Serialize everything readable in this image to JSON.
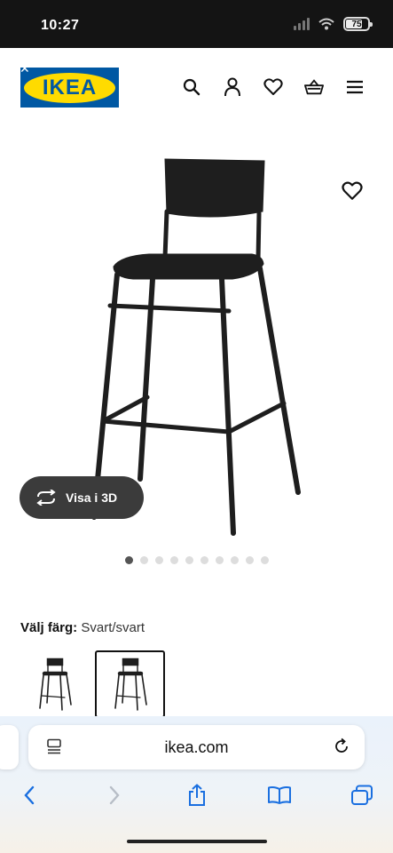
{
  "status_bar": {
    "time": "10:27",
    "battery": "75"
  },
  "header": {
    "logo_text": "IKEA",
    "icons": [
      "search-icon",
      "user-icon",
      "heart-icon",
      "basket-icon",
      "menu-icon"
    ]
  },
  "product": {
    "view_3d_label": "Visa i 3D",
    "image_count": 10,
    "active_image_index": 0
  },
  "color_selector": {
    "label": "Välj färg:",
    "value": "Svart/svart",
    "options": [
      {
        "name": "bar-stool-variant-1",
        "selected": false
      },
      {
        "name": "bar-stool-variant-2",
        "selected": true
      }
    ]
  },
  "browser": {
    "url": "ikea.com",
    "toolbar": [
      "back-icon",
      "forward-icon",
      "share-icon",
      "bookmarks-icon",
      "tabs-icon"
    ]
  },
  "colors": {
    "ikea_blue": "#0058a3",
    "ikea_yellow": "#ffdb00",
    "chair": "#1e1e1e"
  }
}
